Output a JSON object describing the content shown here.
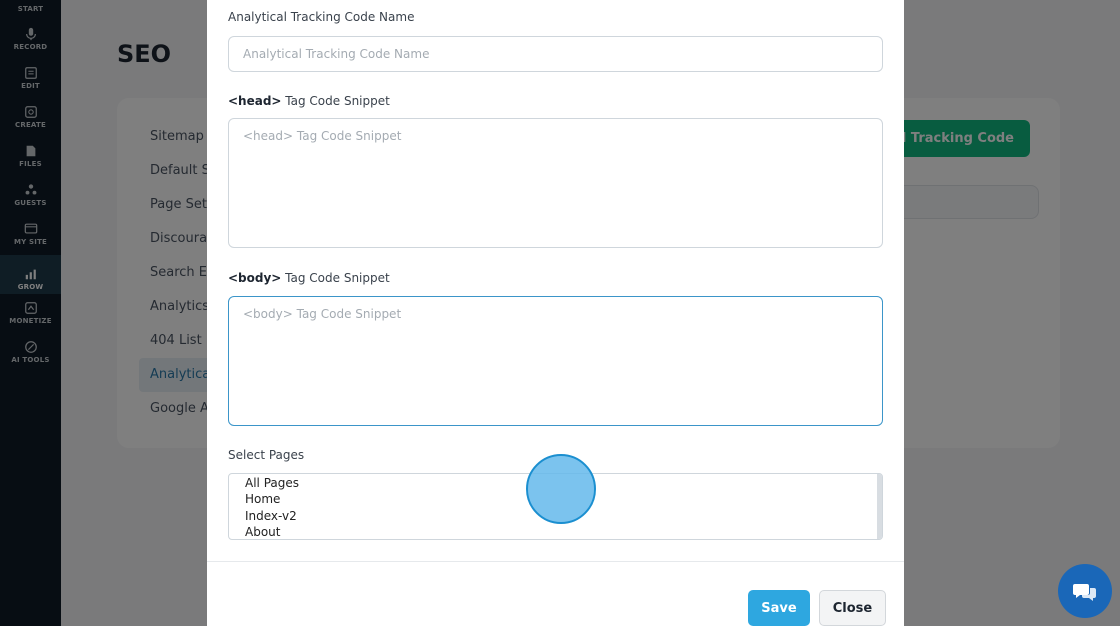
{
  "sidebar": {
    "items": [
      {
        "label": "START",
        "icon": "flag-icon"
      },
      {
        "label": "RECORD",
        "icon": "microphone-icon"
      },
      {
        "label": "EDIT",
        "icon": "edit-icon"
      },
      {
        "label": "CREATE",
        "icon": "create-icon"
      },
      {
        "label": "FILES",
        "icon": "files-icon"
      },
      {
        "label": "GUESTS",
        "icon": "guests-icon"
      },
      {
        "label": "MY SITE",
        "icon": "site-icon"
      },
      {
        "label": "GROW",
        "icon": "chart-icon"
      },
      {
        "label": "MONETIZE",
        "icon": "monetize-icon"
      },
      {
        "label": "AI TOOLS",
        "icon": "ai-icon"
      }
    ],
    "active": "GROW"
  },
  "page": {
    "title": "SEO",
    "settings_nav": [
      "Sitemap G",
      "Default Se",
      "Page Setti",
      "Discourag",
      "Search En",
      "Analytics",
      "404 List",
      "Analytical",
      "Google Ac"
    ],
    "add_button_label": "cal Tracking Code"
  },
  "modal": {
    "name_label": "Analytical Tracking Code Name",
    "name_placeholder": "Analytical Tracking Code Name",
    "head_label_tag": "<head>",
    "head_label_rest": " Tag Code Snippet",
    "head_placeholder": "<head> Tag Code Snippet",
    "body_label_tag": "<body>",
    "body_label_rest": " Tag Code Snippet",
    "body_placeholder": "<body> Tag Code Snippet",
    "pages_label": "Select Pages",
    "pages_options": [
      "All Pages",
      "Home",
      "Index-v2",
      "About"
    ],
    "save_label": "Save",
    "close_label": "Close"
  },
  "colors": {
    "sidebar_bg": "#0e1a26",
    "accent_green": "#10b981",
    "save_blue": "#2ea7e0",
    "chat_blue": "#1a67b8"
  }
}
